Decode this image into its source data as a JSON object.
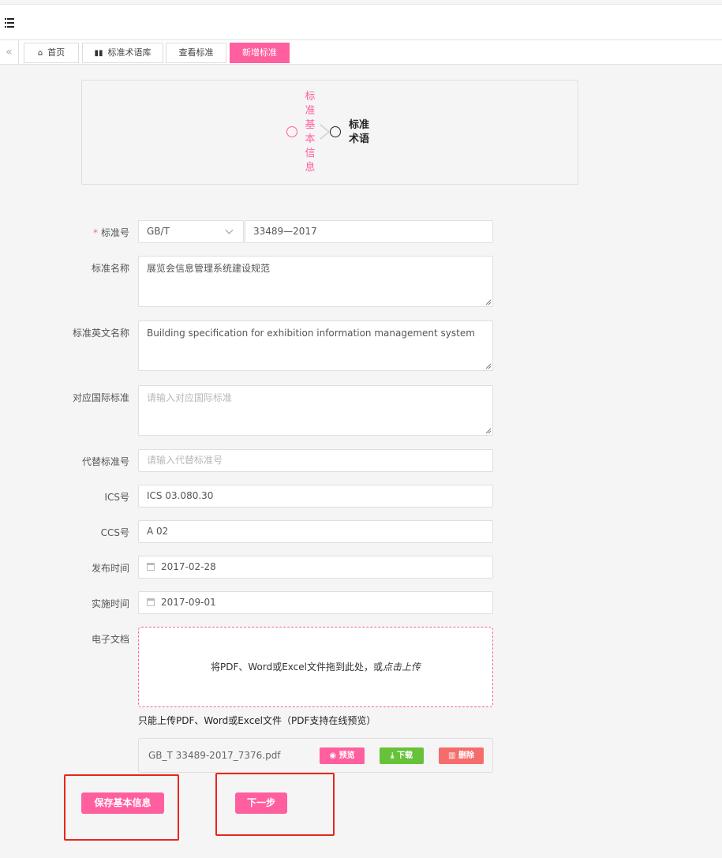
{
  "topbar": {
    "menu_icon": "menu-collapse-icon"
  },
  "tabs": [
    {
      "label": "首页",
      "icon": "home-icon"
    },
    {
      "label": "标准术语库",
      "icon": "book-icon"
    },
    {
      "label": "查看标准"
    },
    {
      "label": "新增标准",
      "active": true
    }
  ],
  "steps": [
    {
      "label": "标准基本信息",
      "active": true
    },
    {
      "label": "标准术语",
      "active": false
    }
  ],
  "form": {
    "standard_no": {
      "label": "标准号",
      "required": true,
      "prefix": "GB/T",
      "number": "33489—2017"
    },
    "name": {
      "label": "标准名称",
      "value": "展览会信息管理系统建设规范"
    },
    "english_name": {
      "label": "标准英文名称",
      "value": "Building specification for exhibition information management system"
    },
    "intl_standard": {
      "label": "对应国际标准",
      "placeholder": "请输入对应国际标准"
    },
    "replace_no": {
      "label": "代替标准号",
      "placeholder": "请输入代替标准号"
    },
    "ics": {
      "label": "ICS号",
      "value": "ICS 03.080.30"
    },
    "ccs": {
      "label": "CCS号",
      "value": "A 02"
    },
    "publish_date": {
      "label": "发布时间",
      "value": "2017-02-28"
    },
    "impl_date": {
      "label": "实施时间",
      "value": "2017-09-01"
    },
    "document": {
      "label": "电子文档",
      "drop_text": "将PDF、Word或Excel文件拖到此处，或",
      "click_text": "点击上传",
      "tip": "只能上传PDF、Word或Excel文件（PDF支持在线预览）",
      "file": {
        "name": "GB_T 33489-2017_7376.pdf",
        "preview": "预览",
        "download": "下载",
        "delete": "删除"
      }
    }
  },
  "actions": {
    "save": "保存基本信息",
    "next": "下一步"
  },
  "colors": {
    "accent": "#ff5f9e",
    "success": "#67c23a",
    "danger": "#f56c6c",
    "highlight": "#e8261b"
  }
}
